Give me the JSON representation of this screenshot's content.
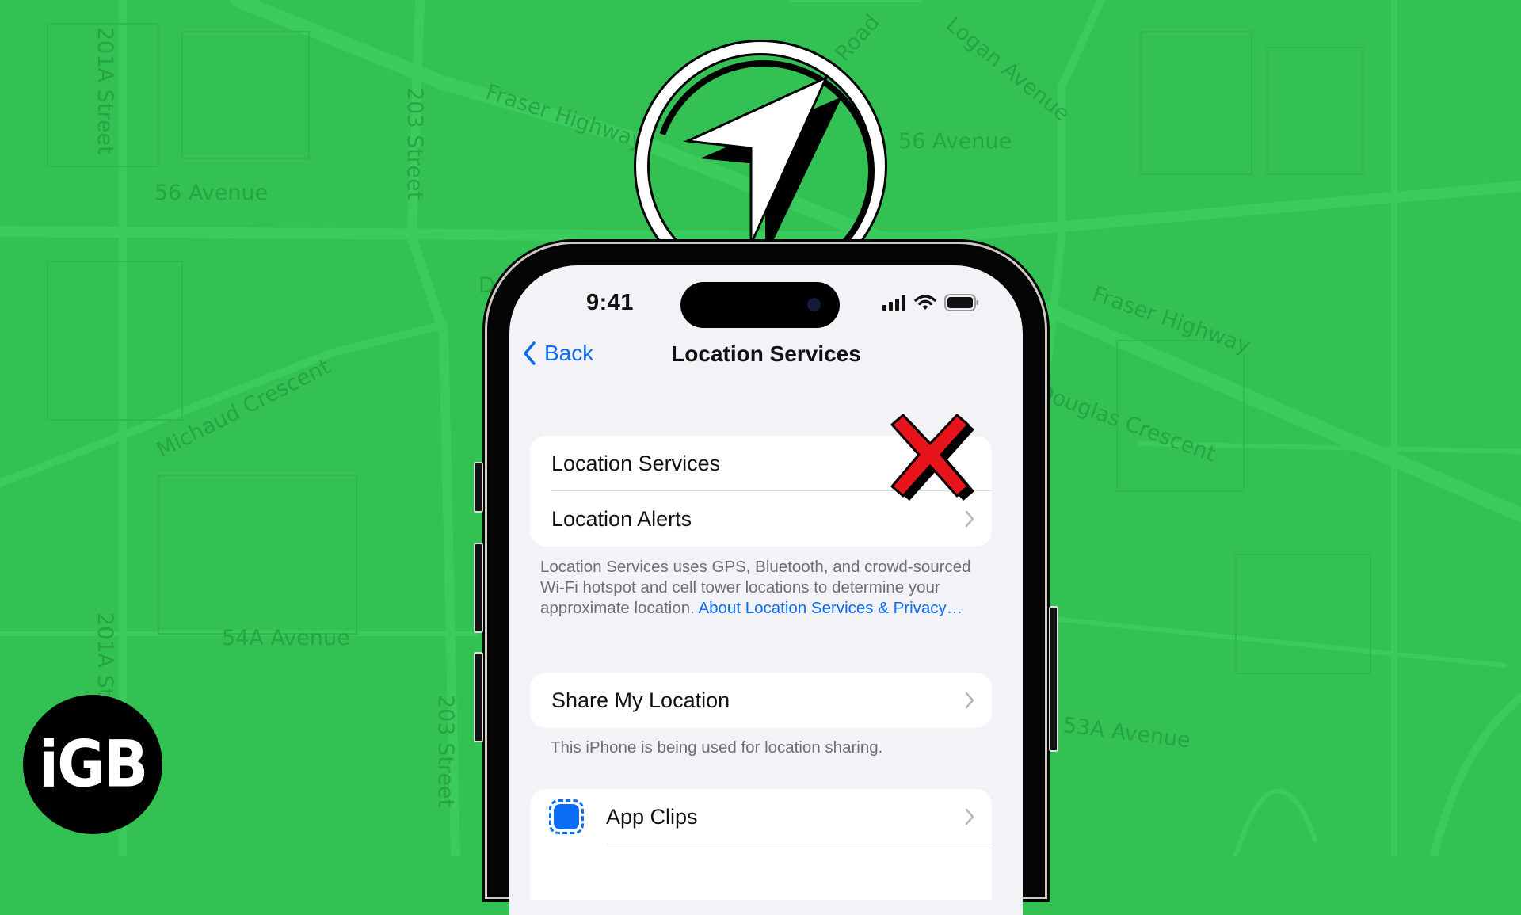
{
  "background": {
    "color": "#33c153",
    "map_labels": [
      "201A Street",
      "203 Street",
      "Fraser Highway",
      "Glover Road",
      "Logan Avenue",
      "56 Avenue",
      "56 Avenue",
      "Fraser Highway",
      "Douglas Crescent",
      "Michaud Crescent",
      "54A Avenue",
      "201A Street",
      "203 Street",
      "53A Avenue",
      "D"
    ]
  },
  "logo": {
    "text": "iGB"
  },
  "overlay": {
    "location_icon": "location-arrow-icon",
    "disabled_mark": "red-x-icon",
    "x_color": "#e8141b"
  },
  "phone": {
    "status_bar": {
      "time": "9:41",
      "icons": [
        "cellular-signal-icon",
        "wifi-icon",
        "battery-icon"
      ]
    },
    "nav": {
      "back_label": "Back",
      "title": "Location Services"
    },
    "groups": [
      {
        "rows": [
          {
            "label": "Location Services",
            "has_chevron": false
          },
          {
            "label": "Location Alerts",
            "has_chevron": true
          }
        ]
      },
      {
        "rows": [
          {
            "label": "Share My Location",
            "has_chevron": true
          }
        ]
      },
      {
        "rows": [
          {
            "label": "App Clips",
            "icon": "app-clips-icon",
            "has_chevron": true
          }
        ]
      }
    ],
    "description": "Location Services uses GPS, Bluetooth, and crowd-sourced Wi-Fi hotspot and cell tower locations to determine your approximate location.",
    "description_link": "About Location Services & Privacy…",
    "share_footnote": "This iPhone is being used for location sharing.",
    "accent_color": "#0a6cf5"
  }
}
